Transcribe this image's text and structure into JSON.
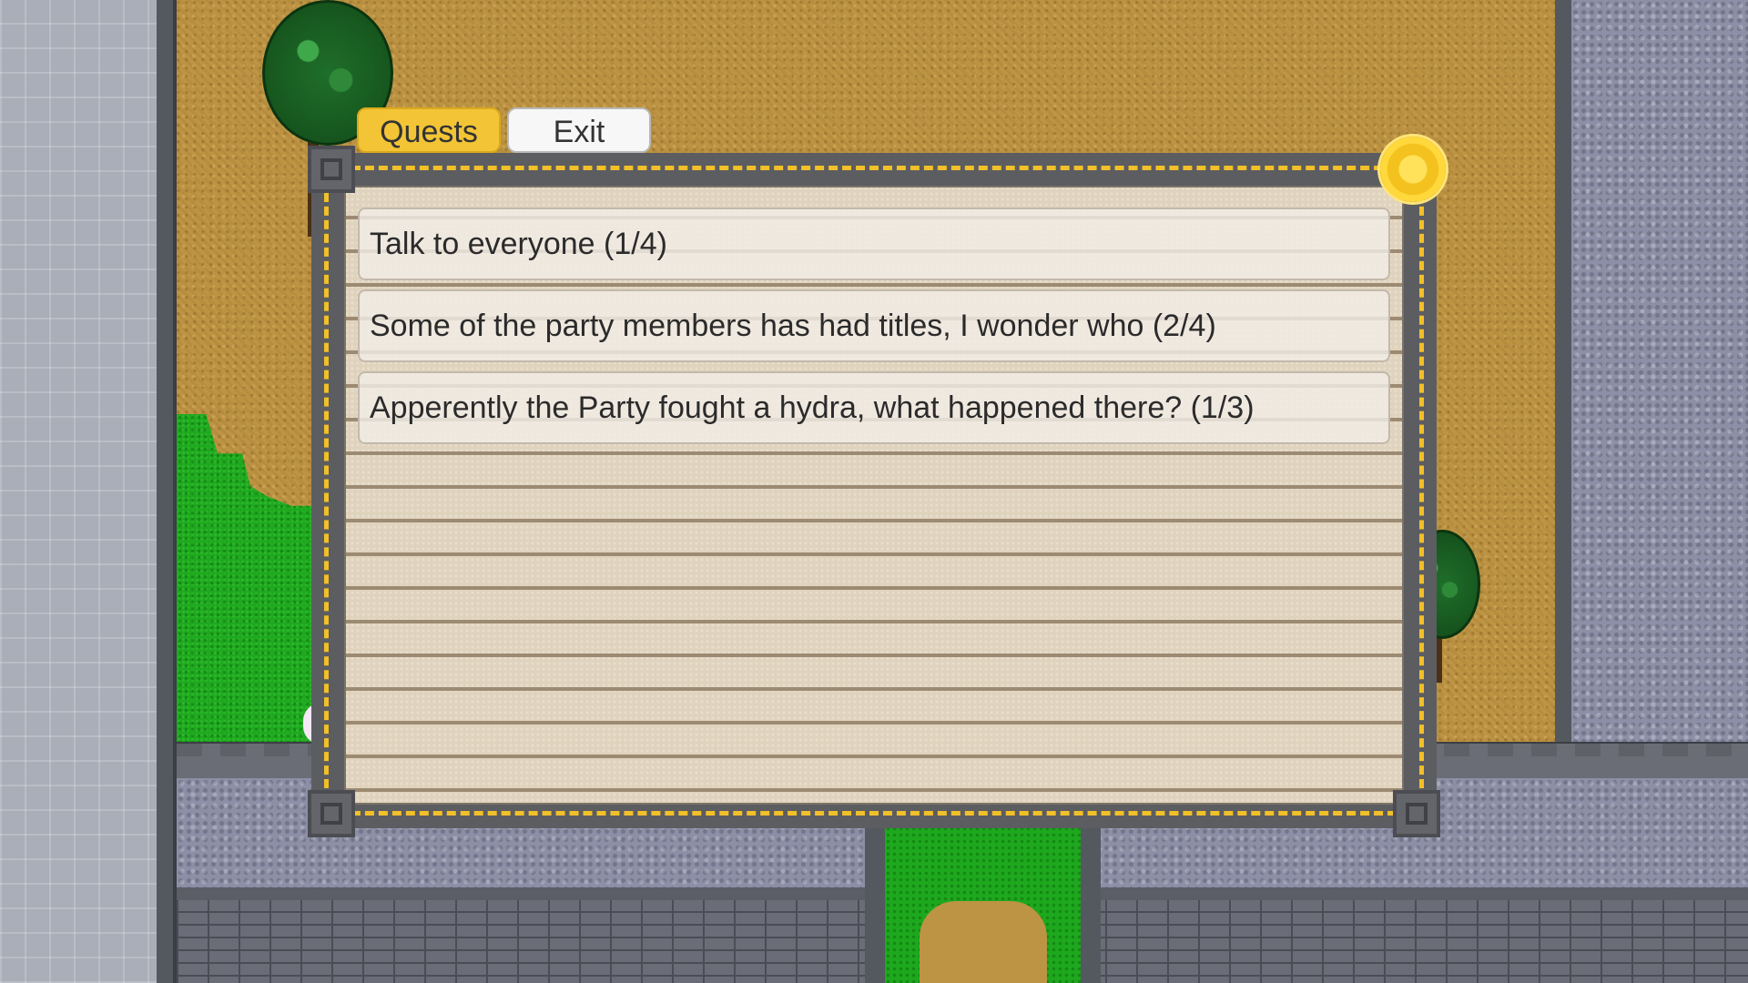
{
  "tabs": {
    "quests_label": "Quests",
    "exit_label": "Exit"
  },
  "quests": [
    {
      "text": "Talk to everyone (1/4)"
    },
    {
      "text": "Some of the party members has had titles, I wonder who (2/4)"
    },
    {
      "text": "Apperently the Party fought a hydra, what happened there? (1/3)"
    }
  ],
  "colors": {
    "active_tab": "#f2c436",
    "inactive_tab": "#f7f7f7",
    "panel_border_gold": "#f2c028",
    "panel_frame": "#5c5d61",
    "paper": "#e0d3bd"
  },
  "icons": {
    "medal": "gold-medal-icon",
    "corner": "spiral-corner-icon"
  }
}
